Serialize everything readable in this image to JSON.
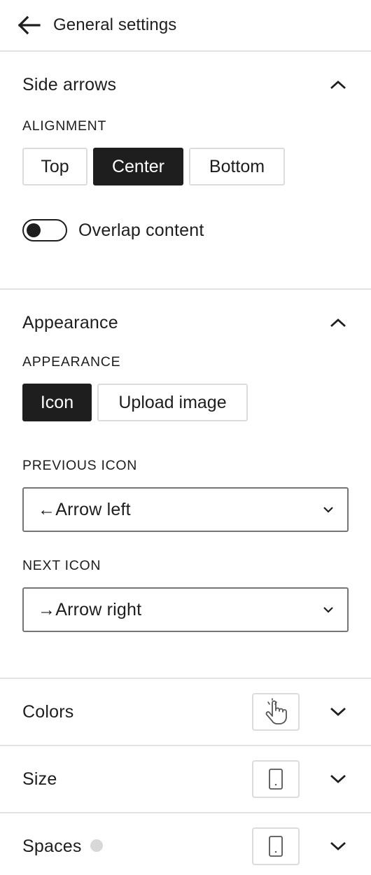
{
  "header": {
    "title": "General settings",
    "back_icon": "arrow-left-icon"
  },
  "side_arrows": {
    "title": "Side arrows",
    "alignment_label": "ALIGNMENT",
    "alignment_options": [
      "Top",
      "Center",
      "Bottom"
    ],
    "alignment_selected": "Center",
    "overlap_label": "Overlap content",
    "overlap_enabled": false
  },
  "appearance": {
    "title": "Appearance",
    "appearance_label": "APPEARANCE",
    "appearance_options": [
      "Icon",
      "Upload image"
    ],
    "appearance_selected": "Icon",
    "previous_icon_label": "PREVIOUS ICON",
    "previous_icon_value": "←Arrow left",
    "next_icon_label": "NEXT ICON",
    "next_icon_value": "→Arrow right"
  },
  "colors": {
    "title": "Colors",
    "device_icon": "pointer-hand-icon"
  },
  "size": {
    "title": "Size",
    "device_icon": "mobile-device-icon"
  },
  "spaces": {
    "title": "Spaces",
    "device_icon": "mobile-device-icon"
  },
  "theme": {
    "accent": "#1e1e1e",
    "border": "#e2e2e2",
    "indicator_dot": "#d8d8d8"
  }
}
